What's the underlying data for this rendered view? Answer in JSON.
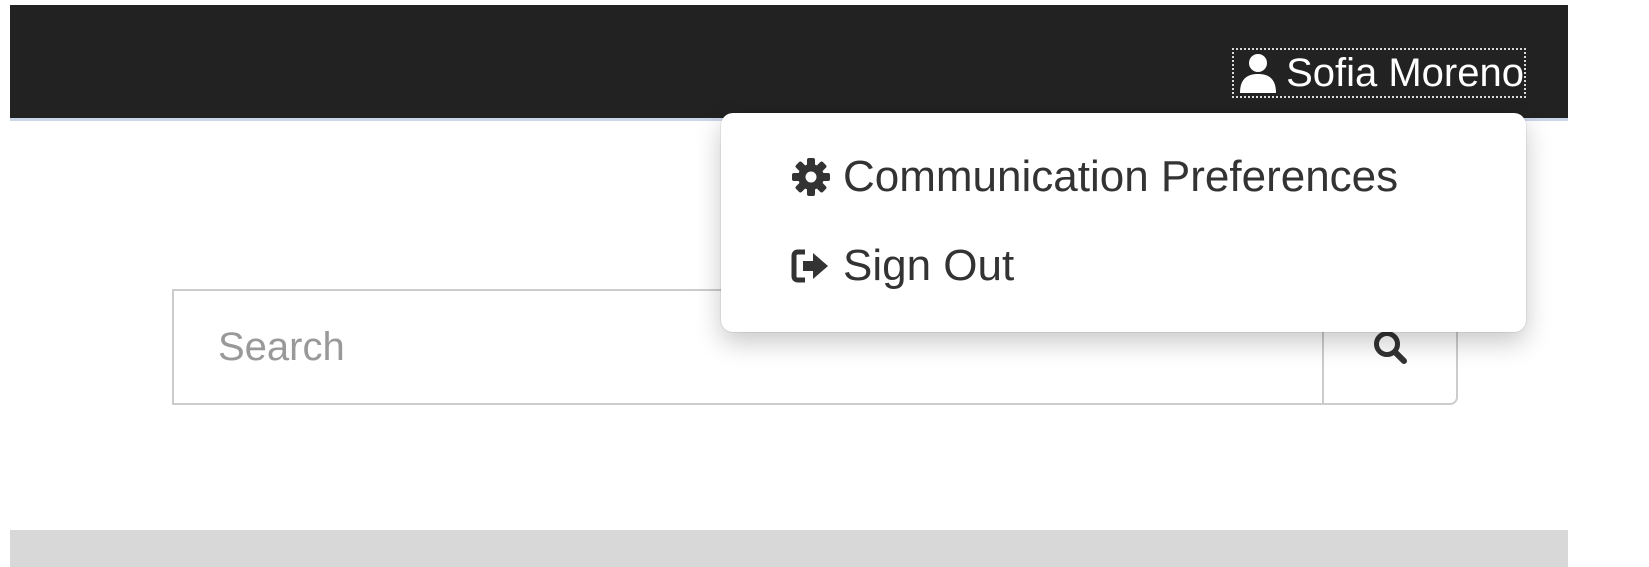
{
  "navbar": {
    "user_menu": {
      "icon": "user-icon",
      "name": "Sofia Moreno"
    }
  },
  "dropdown": {
    "items": [
      {
        "icon": "gear-icon",
        "label": "Communication Preferences"
      },
      {
        "icon": "sign-out-icon",
        "label": "Sign Out"
      }
    ]
  },
  "search": {
    "placeholder": "Search",
    "value": "",
    "button_icon": "search-icon"
  },
  "colors": {
    "navbar_bg": "#222222",
    "text_dark": "#333333",
    "placeholder": "#999999",
    "footer_bg": "#d8d8d8"
  }
}
